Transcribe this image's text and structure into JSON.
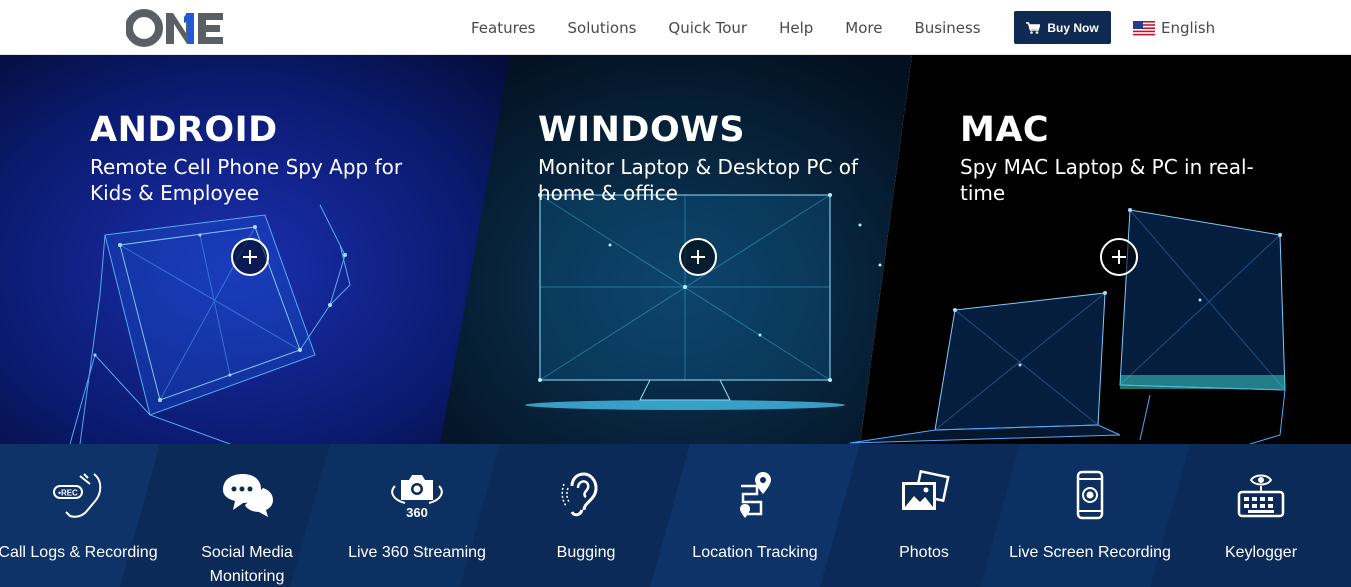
{
  "header": {
    "logo_text": "ONE",
    "nav": [
      "Features",
      "Solutions",
      "Quick Tour",
      "Help",
      "More",
      "Business"
    ],
    "buy_label": "Buy Now",
    "language": "English"
  },
  "hero": {
    "panels": [
      {
        "title": "ANDROID",
        "subtitle": "Remote Cell Phone Spy App for Kids & Employee",
        "icon": "plus-icon"
      },
      {
        "title": "WINDOWS",
        "subtitle": "Monitor Laptop & Desktop PC of home & office",
        "icon": "plus-icon"
      },
      {
        "title": "MAC",
        "subtitle": "Spy MAC Laptop & PC in real-time",
        "icon": "plus-icon"
      }
    ]
  },
  "features": [
    {
      "label": "Call Logs & Recording",
      "icon": "call-recording-icon"
    },
    {
      "label": "Social Media Monitoring",
      "icon": "chat-bubbles-icon"
    },
    {
      "label": "Live 360 Streaming",
      "icon": "camera-360-icon"
    },
    {
      "label": "Bugging",
      "icon": "ear-icon"
    },
    {
      "label": "Location Tracking",
      "icon": "location-pin-icon"
    },
    {
      "label": "Photos",
      "icon": "photos-icon"
    },
    {
      "label": "Live Screen Recording",
      "icon": "phone-screen-icon"
    },
    {
      "label": "Keylogger",
      "icon": "keyboard-icon"
    }
  ],
  "colors": {
    "header_bg": "#ffffff",
    "nav_text": "#4a4a4a",
    "buy_button": "#0f2a52",
    "hero_android": "#0a1a6e",
    "hero_windows": "#061a3a",
    "hero_mac": "#000000",
    "features_strip": "#0b2a58",
    "logo_accent": "#1e5bd6"
  }
}
